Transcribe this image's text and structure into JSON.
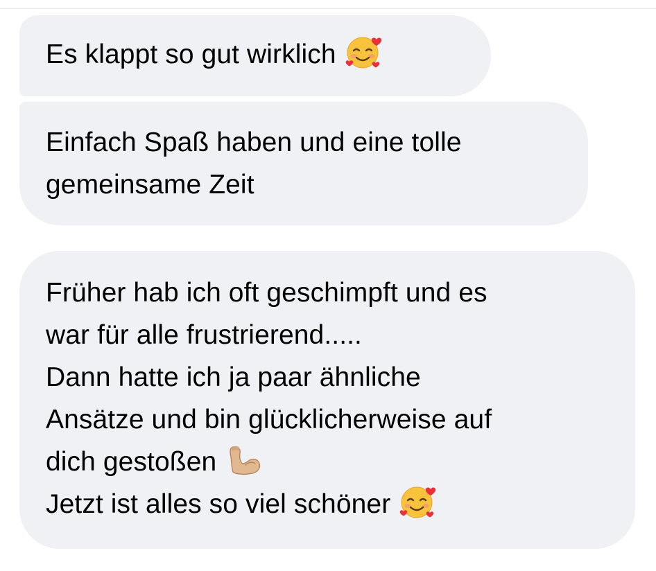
{
  "messages": [
    {
      "lines": [
        {
          "text": "Es klappt so gut wirklich",
          "emoji": "smiling-face-with-hearts-icon"
        }
      ]
    },
    {
      "lines": [
        {
          "text": "Einfach Spaß haben und eine tolle"
        },
        {
          "text": "gemeinsame Zeit"
        }
      ]
    },
    {
      "lines": [
        {
          "text": "Früher hab ich oft geschimpft und es"
        },
        {
          "text": "war für alle frustrierend....."
        },
        {
          "text": "Dann hatte ich ja paar ähnliche"
        },
        {
          "text": "Ansätze und bin glücklicherweise auf"
        },
        {
          "text": "dich gestoßen",
          "emoji": "flexed-biceps-icon"
        },
        {
          "text": "Jetzt ist alles so viel schöner",
          "emoji": "smiling-face-with-hearts-icon"
        }
      ]
    }
  ],
  "colors": {
    "bubble_background": "#f0f1f4",
    "text": "#000000",
    "page_background": "#ffffff"
  }
}
